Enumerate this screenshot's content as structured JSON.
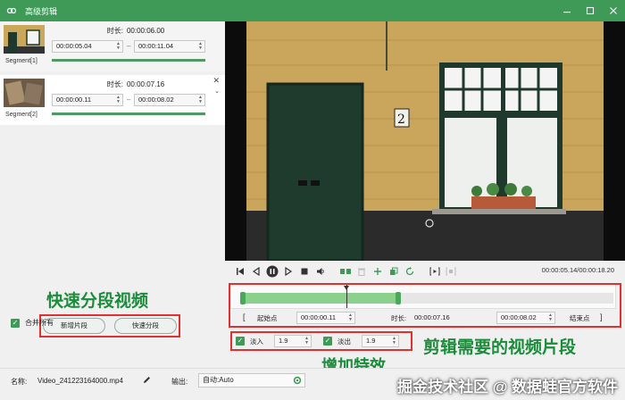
{
  "titlebar": {
    "title": "高级剪辑"
  },
  "segments": [
    {
      "label": "Segment[1]",
      "duration_label": "时长:",
      "duration": "00:00:06.00",
      "start": "00:00:05.04",
      "end": "00:00:11.04",
      "separator": "–",
      "progress": 1.0
    },
    {
      "label": "Segment[2]",
      "duration_label": "时长:",
      "duration": "00:00:07.16",
      "start": "00:00:00.11",
      "end": "00:00:08.02",
      "separator": "–",
      "progress": 1.0
    }
  ],
  "annotations": {
    "quick_split": "快速分段视频",
    "trim_needed": "剪辑需要的视频片段",
    "add_effects": "增加特效",
    "watermark": "掘金技术社区 @ 数据蛙官方软件"
  },
  "left_buttons": {
    "add_segment": "新增片段",
    "fast_split": "快速分段"
  },
  "merge_all": {
    "label": "合并所有",
    "checked": true
  },
  "player": {
    "time_display": "00:00:05.14/00:00:18.20",
    "house_number": "2"
  },
  "timeline": {
    "start_point_label": "起始点",
    "start_time": "00:00:00.11",
    "duration_label": "时长:",
    "duration": "00:00:07.16",
    "end_time": "00:00:08.02",
    "end_point_label": "结束点",
    "left_bracket": "[",
    "right_bracket": "]"
  },
  "effects": {
    "fade_in_label": "淡入",
    "fade_in_value": "1.9",
    "fade_out_label": "淡出",
    "fade_out_value": "1.9"
  },
  "bottom": {
    "name_label": "名称:",
    "file_name": "Video_241223164000.mp4",
    "output_label": "输出:",
    "output_value": "自动:Auto"
  },
  "colors": {
    "accent": "#3f9a58",
    "annotation_green": "#1a8c3a",
    "annotation_red": "#e03030"
  }
}
